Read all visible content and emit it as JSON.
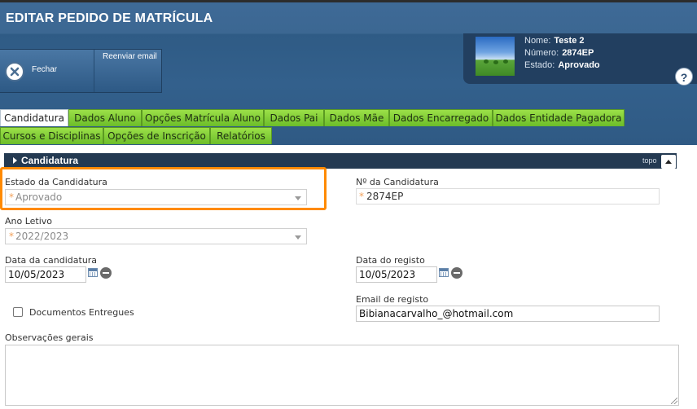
{
  "header": {
    "title": "EDITAR PEDIDO DE MATRÍCULA",
    "fechar_label": "Fechar",
    "reenviar_label": "Reenviar email"
  },
  "info": {
    "nome_label": "Nome:",
    "nome_value": "Teste 2",
    "numero_label": "Número:",
    "numero_value": "2874EP",
    "estado_label": "Estado:",
    "estado_value": "Aprovado",
    "help_label": "?"
  },
  "tabs": [
    {
      "label": "Candidatura",
      "active": true
    },
    {
      "label": "Dados Aluno"
    },
    {
      "label": "Opções Matrícula Aluno"
    },
    {
      "label": "Dados Pai"
    },
    {
      "label": "Dados Mãe"
    },
    {
      "label": "Dados Encarregado"
    },
    {
      "label": "Dados Entidade Pagadora"
    },
    {
      "label": "Cursos e Disciplinas"
    },
    {
      "label": "Opções de Inscrição"
    },
    {
      "label": "Relatórios"
    }
  ],
  "section": {
    "title": "Candidatura",
    "topo_label": "topo"
  },
  "form": {
    "estado_label": "Estado da Candidatura",
    "estado_value": "Aprovado",
    "numero_label": "Nº da Candidatura",
    "numero_value": "2874EP",
    "ano_label": "Ano Letivo",
    "ano_value": "2022/2023",
    "data_cand_label": "Data da candidatura",
    "data_cand_value": "10/05/2023",
    "data_reg_label": "Data do registo",
    "data_reg_value": "10/05/2023",
    "email_label": "Email de registo",
    "email_value": "Bibianacarvalho_@hotmail.com",
    "docs_label": "Documentos Entregues",
    "obs_label": "Observações gerais",
    "required_mark": "*"
  },
  "colors": {
    "header_bg": "#33608c",
    "tab_green": "#7fcc33",
    "highlight": "#ff8a00",
    "section_bar": "#243a52"
  }
}
